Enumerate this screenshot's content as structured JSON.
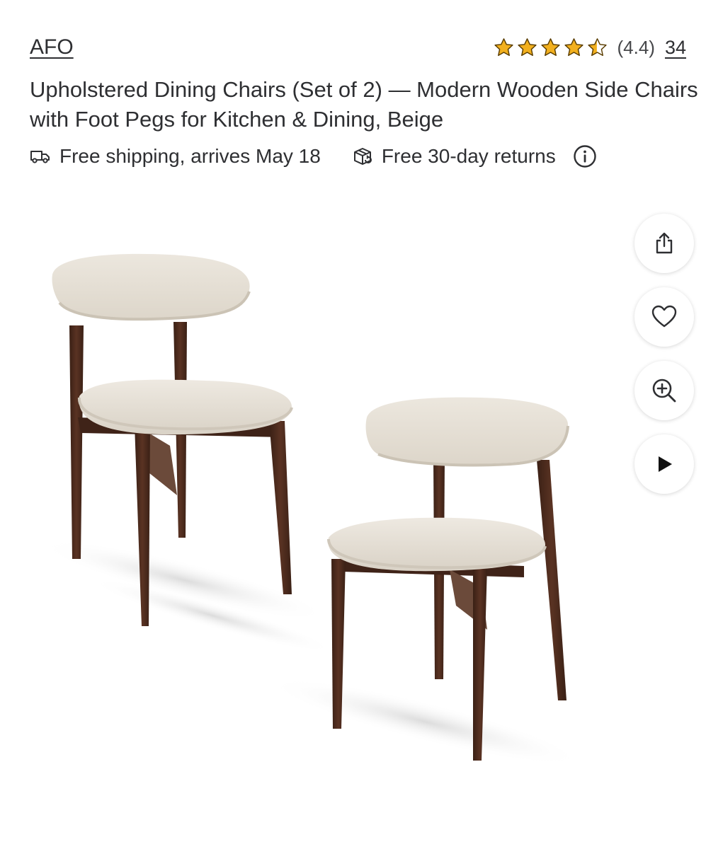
{
  "brand": {
    "name": "AFO"
  },
  "rating": {
    "value_text": "(4.4)",
    "count": "34",
    "stars": 4.4,
    "star_color": "#f2b01e"
  },
  "product": {
    "title": "Upholstered Dining Chairs (Set of 2) — Modern Wooden Side Chairs with Foot Pegs for Kitchen & Dining, Beige"
  },
  "badges": {
    "shipping": {
      "icon": "truck-icon",
      "label": "Free shipping, arrives May 18"
    },
    "returns": {
      "icon": "return-box-icon",
      "label": "Free 30-day returns"
    },
    "info_icon": "info-icon"
  },
  "hero_image": {
    "subject": "two beige upholstered dining chairs with walnut wooden legs",
    "fabric_color": "#e6e0d6",
    "wood_color": "#4a2a1c"
  },
  "side_actions": [
    {
      "icon": "share-icon"
    },
    {
      "icon": "heart-icon"
    },
    {
      "icon": "zoom-in-icon"
    },
    {
      "icon": "play-icon"
    }
  ]
}
